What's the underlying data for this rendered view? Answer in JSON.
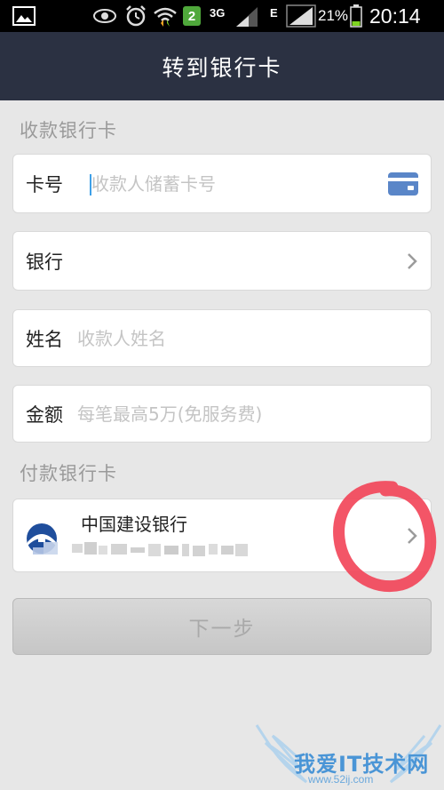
{
  "status_bar": {
    "network_3g": "3G",
    "network_e": "E",
    "battery_percent": "21%",
    "time": "20:14",
    "notification_count": "2"
  },
  "header": {
    "title": "转到银行卡"
  },
  "receive_section": {
    "label": "收款银行卡",
    "card_number": {
      "label": "卡号",
      "placeholder": "收款人储蓄卡号"
    },
    "bank": {
      "label": "银行"
    },
    "name": {
      "label": "姓名",
      "placeholder": "收款人姓名"
    },
    "amount": {
      "label": "金额",
      "placeholder": "每笔最高5万(免服务费)"
    }
  },
  "pay_section": {
    "label": "付款银行卡",
    "bank_name": "中国建设银行"
  },
  "next_button": {
    "label": "下一步"
  },
  "watermark": {
    "title": "我爱IT技术网",
    "url": "www.52ij.com"
  },
  "colors": {
    "header_bg": "#2b3142",
    "page_bg": "#e7e7e7",
    "accent_blue": "#3ea0e8",
    "card_icon_blue": "#5a86c8",
    "circle_red": "#f2465a"
  }
}
